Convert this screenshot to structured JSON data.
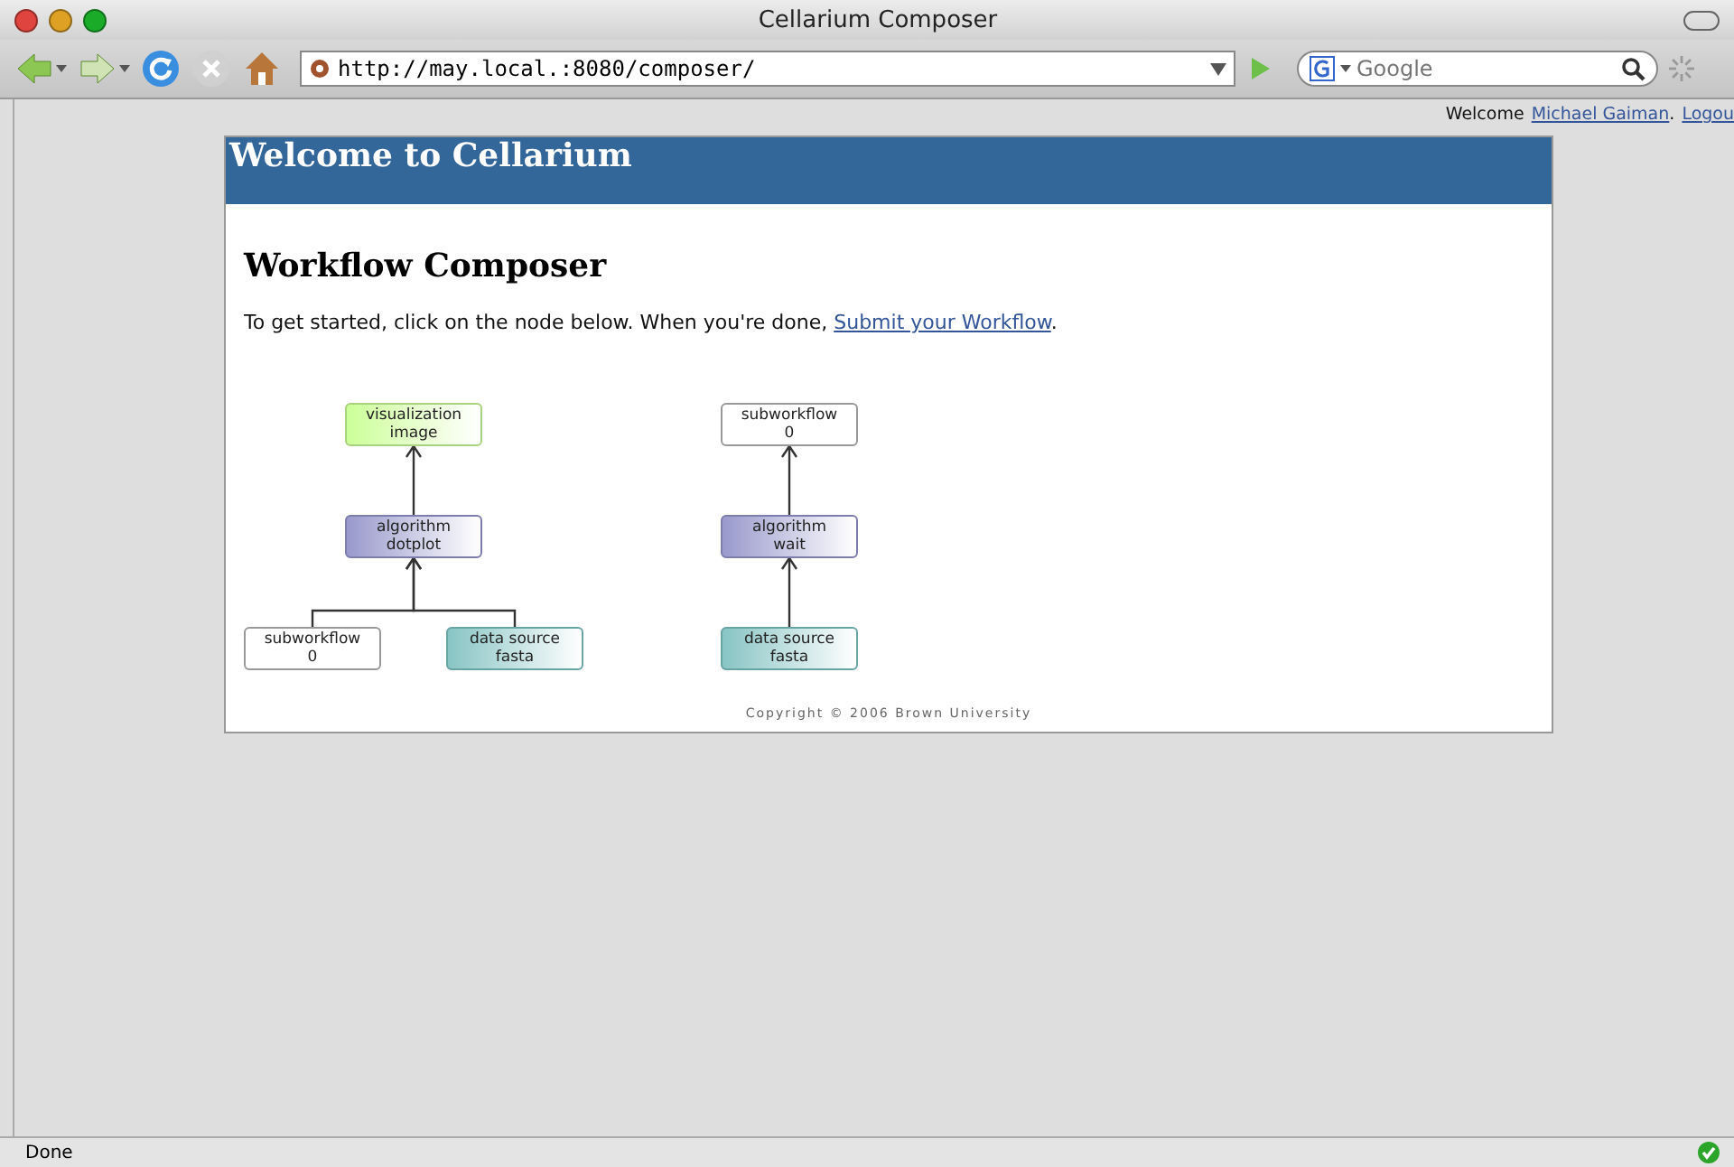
{
  "window": {
    "title": "Cellarium Composer"
  },
  "toolbar": {
    "url": "http://may.local.:8080/composer/",
    "search_placeholder": "Google"
  },
  "account": {
    "greeting": "Welcome",
    "user_link": "Michael Gaiman",
    "separator": ".",
    "logout_link": "Logou"
  },
  "page": {
    "banner": "Welcome to Cellarium",
    "heading": "Workflow Composer",
    "intro": {
      "before": "To get started, click on the node below. When you're done, ",
      "link": "Submit your Workflow",
      "after": "."
    },
    "workflows": [
      {
        "kind": "visualization",
        "lines": [
          "visualization",
          "image"
        ],
        "children": [
          {
            "kind": "algorithm",
            "lines": [
              "algorithm",
              "dotplot"
            ],
            "children": [
              {
                "kind": "subworkflow",
                "lines": [
                  "subworkflow",
                  "0"
                ]
              },
              {
                "kind": "datasource",
                "lines": [
                  "data source",
                  "fasta"
                ]
              }
            ]
          }
        ]
      },
      {
        "kind": "subworkflow",
        "lines": [
          "subworkflow",
          "0"
        ],
        "children": [
          {
            "kind": "algorithm",
            "lines": [
              "algorithm",
              "wait"
            ],
            "children": [
              {
                "kind": "datasource",
                "lines": [
                  "data source",
                  "fasta"
                ]
              }
            ]
          }
        ]
      }
    ],
    "copyright": "Copyright © 2006 Brown University"
  },
  "status_bar": {
    "text": "Done"
  }
}
